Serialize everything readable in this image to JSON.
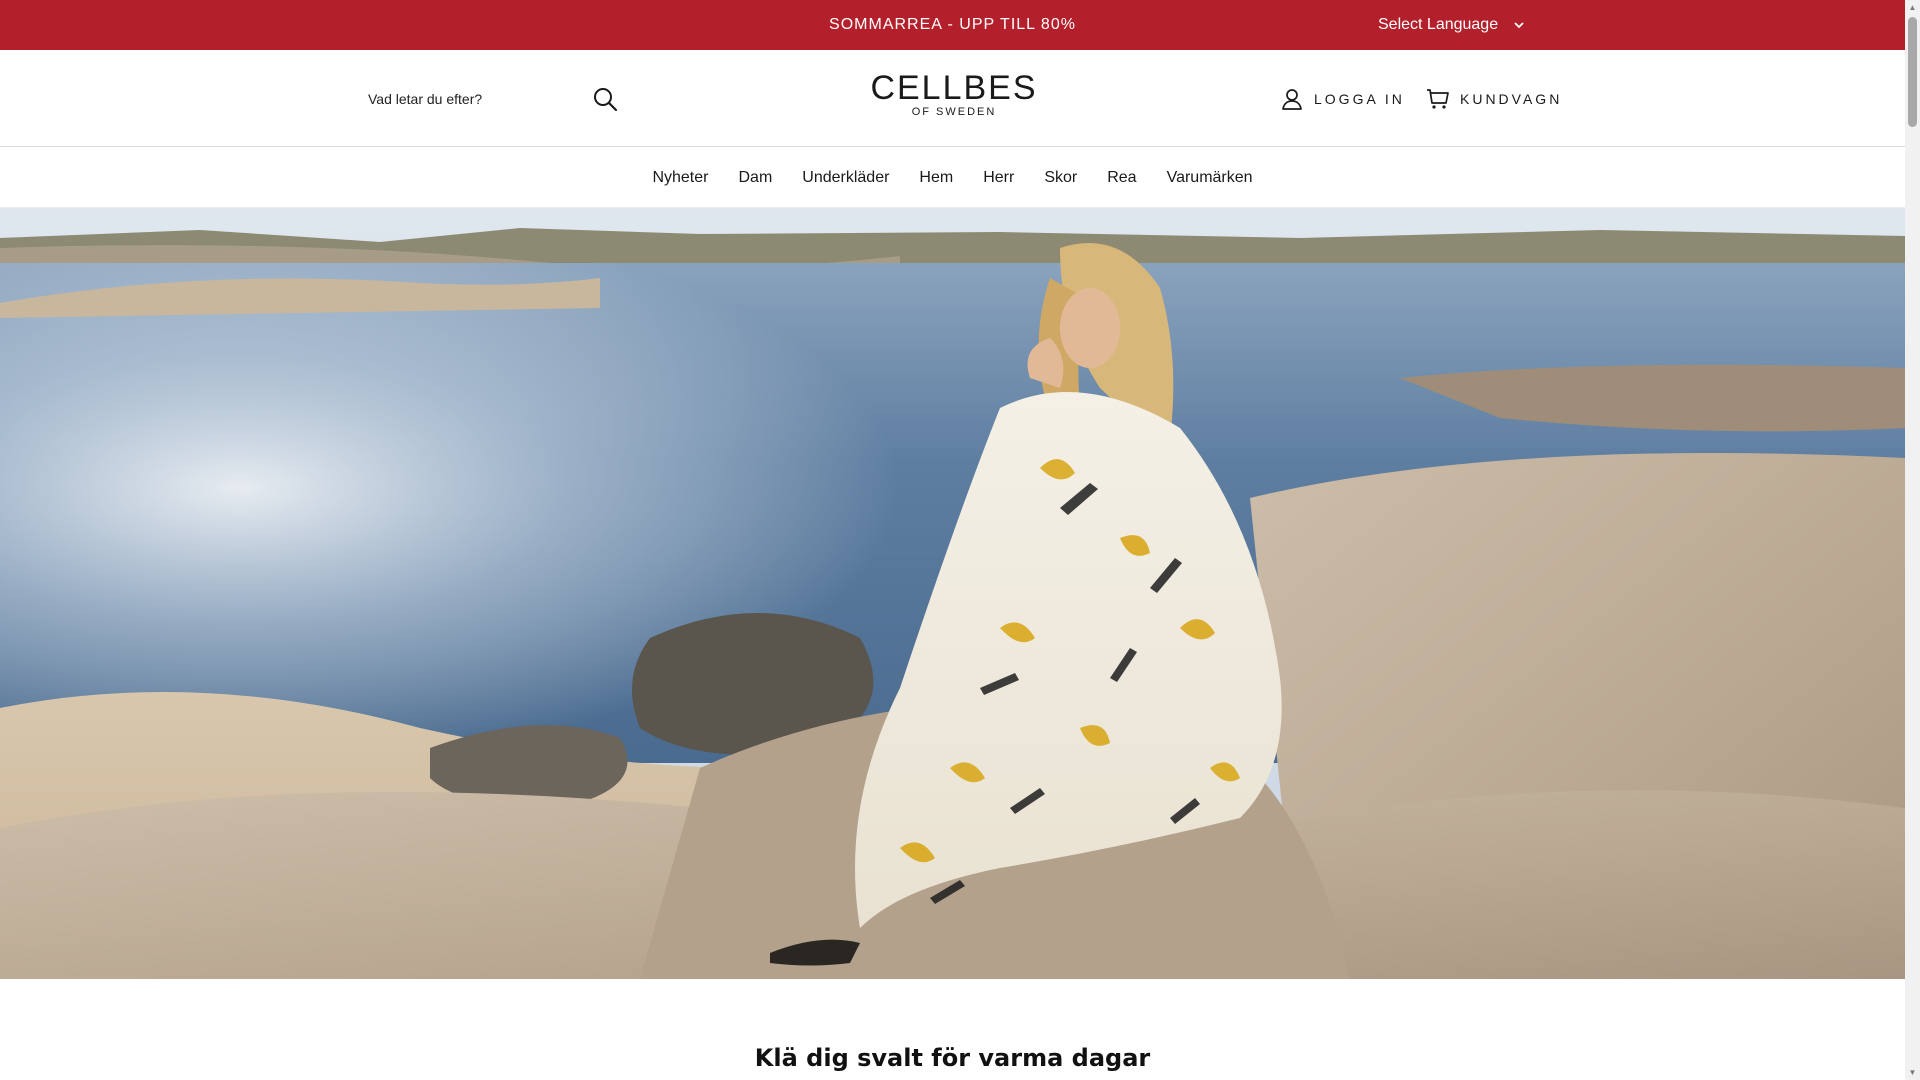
{
  "promo": {
    "text": "SOMMARREA - UPP TILL 80%"
  },
  "language": {
    "selected": "Select Language",
    "icon": "chevron-down-icon"
  },
  "search": {
    "placeholder": "Vad letar du efter?",
    "icon": "search-icon"
  },
  "logo": {
    "main": "CELLBES",
    "sub": "OF SWEDEN"
  },
  "account": {
    "label": "LOGGA IN",
    "icon": "user-icon"
  },
  "cart": {
    "label": "KUNDVAGN",
    "icon": "cart-icon"
  },
  "nav": {
    "items": [
      {
        "label": "Nyheter"
      },
      {
        "label": "Dam"
      },
      {
        "label": "Underkläder"
      },
      {
        "label": "Hem"
      },
      {
        "label": "Herr"
      },
      {
        "label": "Skor"
      },
      {
        "label": "Rea"
      },
      {
        "label": "Varumärken"
      }
    ]
  },
  "hero": {
    "alt": ""
  },
  "section": {
    "heading": "Klä dig svalt för varma dagar"
  },
  "colors": {
    "promo_bg": "#b3202b",
    "text": "#1a1a1a",
    "sea": "#4d6f94",
    "rock": "#bfae9a"
  }
}
